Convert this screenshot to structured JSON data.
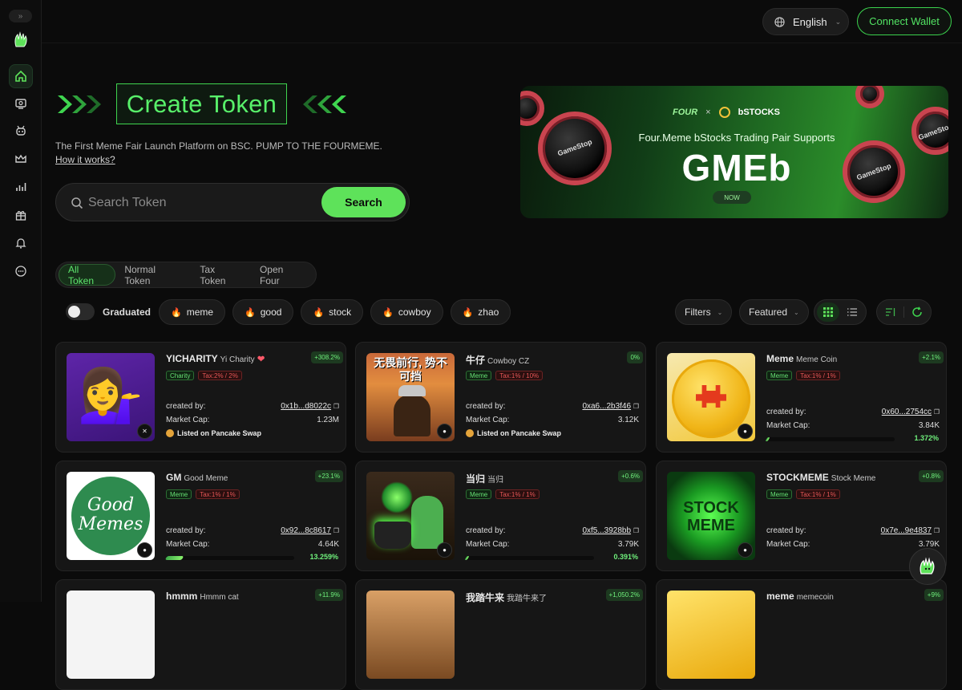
{
  "sidebar": {
    "collapse_label": "»",
    "items": [
      {
        "icon": "home-icon",
        "active": true
      },
      {
        "icon": "ticket-icon"
      },
      {
        "icon": "robot-icon"
      },
      {
        "icon": "crown-icon"
      },
      {
        "icon": "chart-icon"
      },
      {
        "icon": "gift-icon"
      },
      {
        "icon": "bell-icon"
      },
      {
        "icon": "more-icon"
      }
    ]
  },
  "header": {
    "language": "English",
    "connect_label": "Connect Wallet"
  },
  "hero": {
    "title": "Create Token",
    "tagline": "The First Meme Fair Launch Platform on BSC. PUMP TO THE FOURMEME.",
    "how_link": "How it works?",
    "search_placeholder": "Search Token",
    "search_button": "Search"
  },
  "banner": {
    "brand1": "FOUR",
    "separator": "×",
    "brand2": "bSTOCKS",
    "subtitle": "Four.Meme bStocks Trading Pair Supports",
    "headline": "GMEb",
    "badge": "NOW",
    "coin_label": "GameStop"
  },
  "tabs": [
    "All Token",
    "Normal Token",
    "Tax Token",
    "Open Four"
  ],
  "graduated_label": "Graduated",
  "chips": [
    "meme",
    "good",
    "stock",
    "cowboy",
    "zhao"
  ],
  "toolbar": {
    "filters": "Filters",
    "sort": "Featured"
  },
  "labels": {
    "created_by": "created by:",
    "market_cap": "Market Cap:",
    "listed": "Listed on Pancake Swap"
  },
  "cards": [
    {
      "symbol": "YICHARITY",
      "name": "Yi Charity",
      "heart": "❤",
      "change": "+308.2%",
      "tag": "Charity",
      "tax": "Tax:2% / 2%",
      "creator": "0x1b...d8022c",
      "mcap": "1.23M",
      "listed": true,
      "progress": null,
      "progress_label": ""
    },
    {
      "symbol": "牛仔",
      "name": "Cowboy CZ",
      "heart": "",
      "change": "0%",
      "tag": "Meme",
      "tax": "Tax:1% / 10%",
      "creator": "0xa6...2b3f46",
      "mcap": "3.12K",
      "listed": true,
      "progress": null,
      "progress_label": ""
    },
    {
      "symbol": "Meme",
      "name": "Meme Coin",
      "heart": "",
      "change": "+2.1%",
      "tag": "Meme",
      "tax": "Tax:1% / 1%",
      "creator": "0x60...2754cc",
      "mcap": "3.84K",
      "listed": false,
      "progress": 0.01372,
      "progress_label": "1.372%"
    },
    {
      "symbol": "GM",
      "name": "Good Meme",
      "heart": "",
      "change": "+23.1%",
      "tag": "Meme",
      "tax": "Tax:1% / 1%",
      "creator": "0x92...8c8617",
      "mcap": "4.64K",
      "listed": false,
      "progress": 0.13259,
      "progress_label": "13.259%"
    },
    {
      "symbol": "当归",
      "name": "当归",
      "heart": "",
      "change": "+0.6%",
      "tag": "Meme",
      "tax": "Tax:1% / 1%",
      "creator": "0xf5...3928bb",
      "mcap": "3.79K",
      "listed": false,
      "progress": 0.00391,
      "progress_label": "0.391%"
    },
    {
      "symbol": "STOCKMEME",
      "name": "Stock Meme",
      "heart": "",
      "change": "+0.8%",
      "tag": "Meme",
      "tax": "Tax:1% / 1%",
      "creator": "0x7e...9e4837",
      "mcap": "3.79K",
      "listed": false,
      "progress": null,
      "progress_label": ""
    },
    {
      "symbol": "hmmm",
      "name": "Hmmm cat",
      "heart": "",
      "change": "+11.9%",
      "tag": "",
      "tax": "",
      "creator": "",
      "mcap": "",
      "listed": false,
      "progress": null,
      "progress_label": ""
    },
    {
      "symbol": "我踏牛来",
      "name": "我踏牛来了",
      "heart": "",
      "change": "+1,050.2%",
      "tag": "",
      "tax": "",
      "creator": "",
      "mcap": "",
      "listed": false,
      "progress": null,
      "progress_label": ""
    },
    {
      "symbol": "meme",
      "name": "memecoin",
      "heart": "",
      "change": "+9%",
      "tag": "",
      "tax": "",
      "creator": "",
      "mcap": "",
      "listed": false,
      "progress": null,
      "progress_label": ""
    }
  ],
  "card_images": {
    "yicharity_emoji": "💁‍♀️",
    "goodmemes_text": "Good Memes",
    "cowboy_text": "无畏前行, 势不可挡",
    "stock_text": "STOCK MEME"
  }
}
